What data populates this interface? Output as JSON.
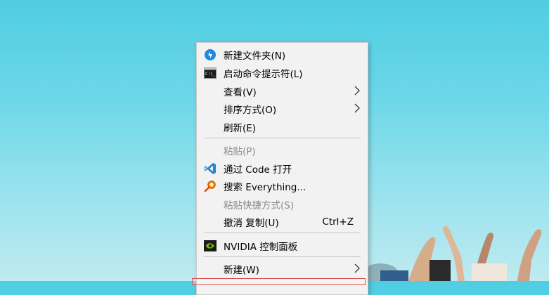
{
  "context_menu": {
    "items": [
      {
        "label": "新建文件夹(N)",
        "icon": "new-folder-icon",
        "enabled": true
      },
      {
        "label": "启动命令提示符(L)",
        "icon": "command-prompt-icon",
        "enabled": true
      },
      {
        "label": "查看(V)",
        "submenu": true,
        "enabled": true
      },
      {
        "label": "排序方式(O)",
        "submenu": true,
        "enabled": true
      },
      {
        "label": "刷新(E)",
        "enabled": true
      },
      {
        "label": "粘贴(P)",
        "enabled": false
      },
      {
        "label": "通过 Code 打开",
        "icon": "vscode-icon",
        "enabled": true
      },
      {
        "label": "搜索 Everything...",
        "icon": "everything-search-icon",
        "enabled": true
      },
      {
        "label": "粘贴快捷方式(S)",
        "enabled": false
      },
      {
        "label": "撤消 复制(U)",
        "shortcut": "Ctrl+Z",
        "enabled": true
      },
      {
        "label": "NVIDIA 控制面板",
        "icon": "nvidia-icon",
        "enabled": true
      },
      {
        "label": "新建(W)",
        "submenu": true,
        "enabled": true
      }
    ]
  },
  "colors": {
    "menu_background": "#f2f2f2",
    "separator": "#c8c8c8",
    "disabled_text": "#8a8a8a",
    "sky": "#4fcde2"
  }
}
